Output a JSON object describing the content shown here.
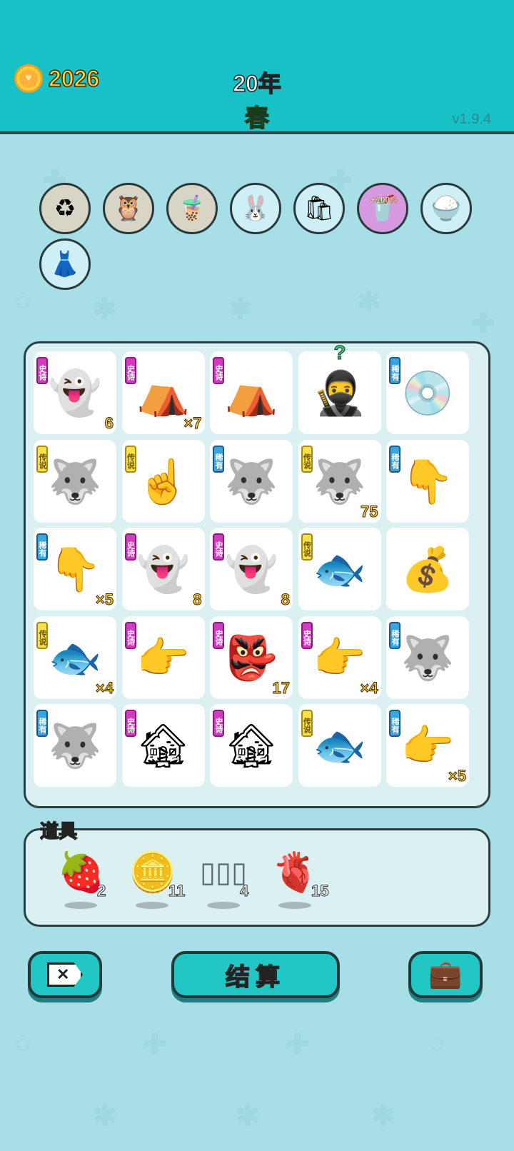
{
  "header": {
    "coins": "2026",
    "year": "20年",
    "season": "春",
    "version": "v1.9.4"
  },
  "perks": [
    {
      "name": "refresh-perk",
      "icon": "♻"
    },
    {
      "name": "owls-perk",
      "icon": "🦉"
    },
    {
      "name": "bubble-tea-perk",
      "icon": "🧋"
    },
    {
      "name": "rabbit-perk",
      "icon": "🐰"
    },
    {
      "name": "recycle-bag-perk",
      "icon": "🛍"
    },
    {
      "name": "tea-bonus-perk",
      "icon": "🥤",
      "badge": "+100%"
    },
    {
      "name": "rice-bowl-perk",
      "icon": "🍚"
    },
    {
      "name": "skirt-perk",
      "icon": "👗"
    }
  ],
  "rarity_labels": {
    "epic": "史诗",
    "rare": "稀有",
    "legend": "传说"
  },
  "board": [
    [
      {
        "item": "ghost",
        "icon": "👻",
        "rarity": "epic",
        "count": "6"
      },
      {
        "item": "rabbit-tent",
        "icon": "⛺",
        "rarity": "epic",
        "count": "×7"
      },
      {
        "item": "rabbit-tent",
        "icon": "⛺",
        "rarity": "epic",
        "count": ""
      },
      {
        "item": "thief",
        "icon": "🥷",
        "rarity": "",
        "count": "",
        "mark": "?"
      },
      {
        "item": "cd-disc",
        "icon": "💿",
        "rarity": "rare",
        "count": ""
      }
    ],
    [
      {
        "item": "husky-king",
        "icon": "🐺",
        "rarity": "legend",
        "count": ""
      },
      {
        "item": "yellow-pointer",
        "icon": "☝",
        "rarity": "legend",
        "count": ""
      },
      {
        "item": "husky",
        "icon": "🐺",
        "rarity": "rare",
        "count": ""
      },
      {
        "item": "husky-king",
        "icon": "🐺",
        "rarity": "legend",
        "count": "75"
      },
      {
        "item": "brown-pointer",
        "icon": "👇",
        "rarity": "rare",
        "count": ""
      }
    ],
    [
      {
        "item": "brown-pointer",
        "icon": "👇",
        "rarity": "rare",
        "count": "×5"
      },
      {
        "item": "ghost",
        "icon": "👻",
        "rarity": "epic",
        "count": "8"
      },
      {
        "item": "ghost",
        "icon": "👻",
        "rarity": "epic",
        "count": "8"
      },
      {
        "item": "koi-fish",
        "icon": "🐟",
        "rarity": "legend",
        "count": ""
      },
      {
        "item": "coin-pile",
        "icon": "💰",
        "rarity": "",
        "count": ""
      }
    ],
    [
      {
        "item": "koi-fish",
        "icon": "🐟",
        "rarity": "legend",
        "count": "×4"
      },
      {
        "item": "gray-pointer",
        "icon": "👉",
        "rarity": "epic",
        "count": ""
      },
      {
        "item": "black-white-impermanence",
        "icon": "👺",
        "rarity": "epic",
        "count": "17"
      },
      {
        "item": "gray-pointer",
        "icon": "👉",
        "rarity": "epic",
        "count": "×4"
      },
      {
        "item": "husky",
        "icon": "🐺",
        "rarity": "rare",
        "count": ""
      }
    ],
    [
      {
        "item": "husky",
        "icon": "🐺",
        "rarity": "rare",
        "count": ""
      },
      {
        "item": "haunted-house",
        "icon": "🏚",
        "rarity": "epic",
        "count": ""
      },
      {
        "item": "haunted-house",
        "icon": "🏚",
        "rarity": "epic",
        "count": ""
      },
      {
        "item": "koi-fish",
        "icon": "🐟",
        "rarity": "legend",
        "count": ""
      },
      {
        "item": "brown-pointer",
        "icon": "👉",
        "rarity": "rare",
        "count": "×5"
      }
    ]
  ],
  "items_panel": {
    "title": "道具",
    "props": [
      {
        "name": "strawberry-prop",
        "icon": "🍓",
        "count": "2"
      },
      {
        "name": "coin-prop",
        "icon": "🪙",
        "count": "11"
      },
      {
        "name": "slots-prop",
        "icon": "▯▯▯",
        "count": "4"
      },
      {
        "name": "liver-prop",
        "icon": "🫀",
        "count": "15"
      }
    ]
  },
  "buttons": {
    "settle": "结算",
    "exit_icon": "✕",
    "bag_icon": "💼"
  }
}
